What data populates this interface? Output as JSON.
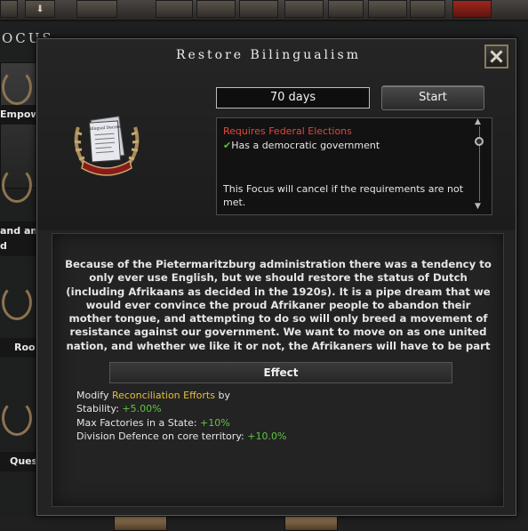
{
  "background": {
    "focus_tab_label": "OCUS",
    "side_labels": [
      "Empow",
      "and anc",
      "d",
      "Roo",
      "Ques"
    ]
  },
  "dialog": {
    "title": "Restore Bilingualism",
    "icon_caption": "Bilingual Decree",
    "days_label": "70 days",
    "start_label": "Start",
    "requirements": {
      "title": "Requires Federal Elections",
      "check_mark": "✔",
      "condition": "Has a democratic government",
      "cancel_note": "This Focus will cancel if the requirements are not met."
    },
    "description": "Because of the Pietermaritzburg administration there was a tendency to only ever use English, but we should restore the status of Dutch (including Afrikaans as decided in the 1920s). It is a pipe dream that we would ever convince the proud Afrikaner people to abandon their mother tongue, and attempting to do so will only breed a movement of resistance against our government. We want to move on as one united nation, and whether we like it or not, the Afrikaners will have to be part",
    "effect_header": "Effect",
    "effects": {
      "modify_prefix": "Modify ",
      "modify_target": "Reconciliation Efforts",
      "modify_suffix": " by",
      "lines": [
        {
          "label": "Stability: ",
          "value": "+5.00%"
        },
        {
          "label": "Max Factories in a State: ",
          "value": "+10%"
        },
        {
          "label": "Division Defence on core territory: ",
          "value": "+10.0%"
        }
      ]
    }
  },
  "colors": {
    "requirement_red": "#e0483c",
    "positive_green": "#5ec442",
    "highlight_gold": "#e5bf3d"
  }
}
